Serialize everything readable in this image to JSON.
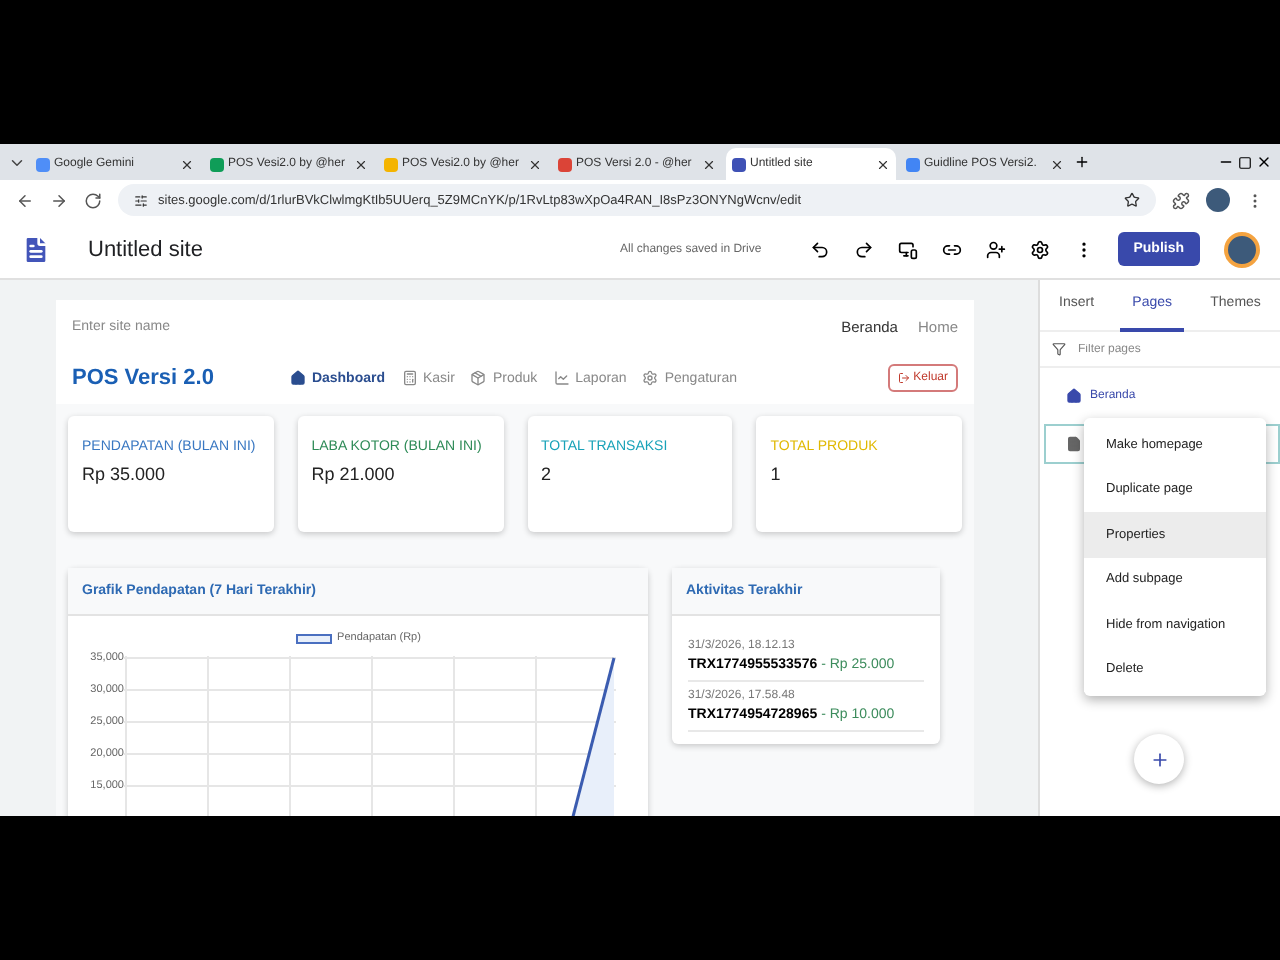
{
  "browser": {
    "tabs": [
      {
        "title": "Google Gemini",
        "color": "#4f8ef7",
        "selected": false
      },
      {
        "title": "POS Vesi2.0 by @her",
        "color": "#0f9d58",
        "selected": false
      },
      {
        "title": "POS Vesi2.0 by @her",
        "color": "#f4b400",
        "selected": false
      },
      {
        "title": "POS Versi 2.0 - @her",
        "color": "#db4437",
        "selected": false
      },
      {
        "title": "Untitled site",
        "color": "#3f51b5",
        "selected": true
      },
      {
        "title": "Guidline POS Versi2.",
        "color": "#4285f4",
        "selected": false
      }
    ],
    "url": "sites.google.com/d/1rlurBVkClwlmgKtIb5UUerq_5Z9MCnYK/p/1RvLtp83wXpOa4RAN_I8sPz3ONYNgWcnv/edit"
  },
  "editor": {
    "title": "Untitled site",
    "save_status": "All changes saved in Drive",
    "publish": "Publish"
  },
  "site": {
    "site_name_placeholder": "Enter site name",
    "top_nav": [
      "Beranda",
      "Home"
    ],
    "brand": "POS Versi 2.0",
    "nav": [
      {
        "label": "Dashboard",
        "selected": true
      },
      {
        "label": "Kasir",
        "selected": false
      },
      {
        "label": "Produk",
        "selected": false
      },
      {
        "label": "Laporan",
        "selected": false
      },
      {
        "label": "Pengaturan",
        "selected": false
      }
    ],
    "logout": "Keluar",
    "stats": [
      {
        "label": "PENDAPATAN (BULAN INI)",
        "value": "Rp 35.000",
        "color": "#3a78c2"
      },
      {
        "label": "LABA KOTOR (BULAN INI)",
        "value": "Rp 21.000",
        "color": "#2e8b57"
      },
      {
        "label": "TOTAL TRANSAKSI",
        "value": "2",
        "color": "#17a2b8"
      },
      {
        "label": "TOTAL PRODUK",
        "value": "1",
        "color": "#e0b800"
      }
    ],
    "chart_panel": {
      "title": "Grafik Pendapatan (7 Hari Terakhir)",
      "legend": "Pendapatan (Rp)",
      "y_ticks": [
        "35,000",
        "30,000",
        "25,000",
        "20,000",
        "15,000"
      ]
    },
    "activity": {
      "title": "Aktivitas Terakhir",
      "items": [
        {
          "time": "31/3/2026, 18.12.13",
          "id": "TRX1774955533576",
          "amount": "- Rp 25.000"
        },
        {
          "time": "31/3/2026, 17.58.48",
          "id": "TRX1774954728965",
          "amount": "- Rp 10.000"
        }
      ]
    }
  },
  "panel": {
    "tabs": [
      {
        "label": "Insert",
        "selected": false
      },
      {
        "label": "Pages",
        "selected": true
      },
      {
        "label": "Themes",
        "selected": false
      }
    ],
    "filter_placeholder": "Filter pages",
    "pages": [
      {
        "label": "Beranda",
        "kind": "home",
        "selected": false
      },
      {
        "kind": "page",
        "selected": true
      }
    ],
    "menu": [
      {
        "label": "Make homepage",
        "selected": false
      },
      {
        "label": "Duplicate page",
        "selected": false
      },
      {
        "label": "Properties",
        "selected": true
      },
      {
        "label": "Add subpage",
        "selected": false
      },
      {
        "label": "Hide from navigation",
        "selected": false
      },
      {
        "label": "Delete",
        "selected": false
      }
    ]
  }
}
